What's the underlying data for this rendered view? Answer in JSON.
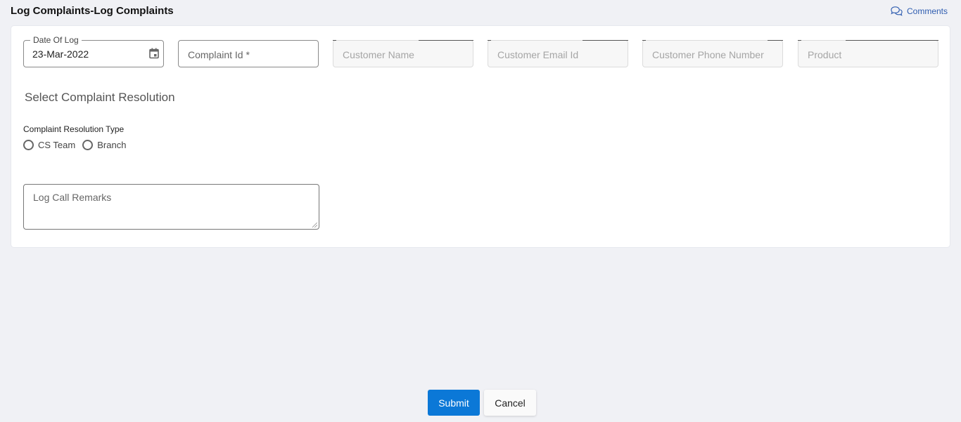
{
  "header": {
    "title": "Log Complaints-Log Complaints",
    "comments_label": "Comments",
    "comments_icon": "chat-bubbles-icon"
  },
  "form": {
    "date_of_log": {
      "label": "Date Of Log",
      "value": "23-Mar-2022",
      "icon": "calendar-icon"
    },
    "complaint_id": {
      "placeholder": "Complaint Id *",
      "value": ""
    },
    "customer_name": {
      "placeholder": "Customer Name",
      "value": "",
      "disabled": true
    },
    "customer_email": {
      "placeholder": "Customer Email Id",
      "value": "",
      "disabled": true
    },
    "customer_phone": {
      "placeholder": "Customer Phone Number",
      "value": "",
      "disabled": true
    },
    "product": {
      "placeholder": "Product",
      "value": "",
      "disabled": true
    },
    "section_title": "Select Complaint Resolution",
    "resolution_type": {
      "label": "Complaint Resolution Type",
      "options": [
        {
          "label": "CS Team",
          "selected": false
        },
        {
          "label": "Branch",
          "selected": false
        }
      ]
    },
    "remarks": {
      "placeholder": "Log Call Remarks",
      "value": ""
    }
  },
  "actions": {
    "submit_label": "Submit",
    "cancel_label": "Cancel",
    "submit_color": "#0b78d7"
  }
}
